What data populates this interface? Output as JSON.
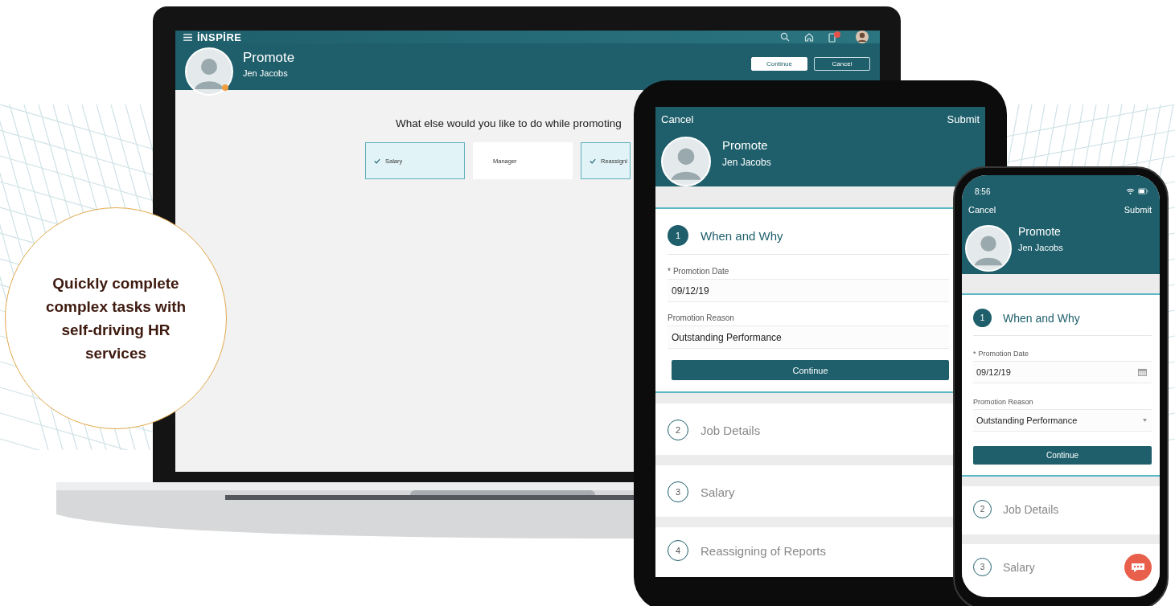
{
  "laptop": {
    "logo": "İNSPİRE",
    "title": "Promote",
    "subtitle": "Jen Jacobs",
    "buttons": [
      {
        "label": "Continue",
        "kind": "primary"
      },
      {
        "label": "Cancel",
        "kind": "outline"
      }
    ],
    "question": "What else would you like to do while promoting",
    "options": [
      {
        "label": "Salary",
        "checked": true
      },
      {
        "label": "Manager",
        "checked": false
      },
      {
        "label": "Reassigni",
        "checked": true
      }
    ]
  },
  "tablet": {
    "nav": {
      "cancel": "Cancel",
      "submit": "Submit"
    },
    "title": "Promote",
    "subtitle": "Jen Jacobs",
    "steps": [
      {
        "number": "1",
        "title": "When and Why",
        "active": true,
        "fields": [
          {
            "label": "Promotion Date",
            "required_mark": "*",
            "value": "09/12/19"
          },
          {
            "label": "Promotion Reason",
            "value": "Outstanding Performance"
          }
        ],
        "button": "Continue"
      },
      {
        "number": "2",
        "title": "Job Details",
        "active": false
      },
      {
        "number": "3",
        "title": "Salary",
        "active": false
      },
      {
        "number": "4",
        "title": "Reassigning of Reports",
        "active": false
      }
    ]
  },
  "phone": {
    "time": "8:56",
    "nav": {
      "cancel": "Cancel",
      "submit": "Submit"
    },
    "title": "Promote",
    "subtitle": "Jen Jacobs",
    "steps": [
      {
        "number": "1",
        "title": "When and Why",
        "active": true,
        "fields": [
          {
            "label": "Promotion Date",
            "required_mark": "*",
            "value": "09/12/19",
            "kind": "date"
          },
          {
            "label": "Promotion Reason",
            "value": "Outstanding Performance",
            "kind": "select"
          }
        ],
        "button": "Continue"
      },
      {
        "number": "2",
        "title": "Job Details",
        "active": false
      },
      {
        "number": "3",
        "title": "Salary",
        "active": false
      }
    ]
  },
  "callout": "Quickly complete complex tasks with self-driving HR services"
}
